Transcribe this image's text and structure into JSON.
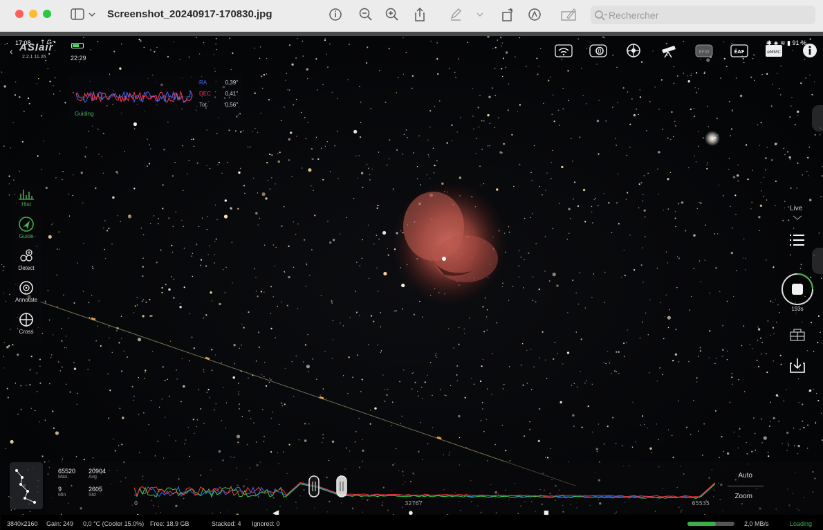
{
  "window": {
    "title": "Screenshot_20240917-170830.jpg",
    "search_placeholder": "Rechercher"
  },
  "status": {
    "time": "17:08",
    "indicators": "⇡ G •",
    "right": "✱ ◈ ≋ ▮ 91 %",
    "clock": "22:29"
  },
  "app": {
    "logo": "ASIair",
    "version": "2.2.1 11.26"
  },
  "devices": [
    {
      "name": "wifi-icon",
      "label": ""
    },
    {
      "name": "camera-icon",
      "label": "0"
    },
    {
      "name": "guide-scope-icon",
      "label": ""
    },
    {
      "name": "telescope-icon",
      "label": ""
    },
    {
      "name": "filter-wheel-icon",
      "label": "EFW"
    },
    {
      "name": "focuser-icon",
      "label": "EAF"
    },
    {
      "name": "storage-icon",
      "label": "eMMC"
    },
    {
      "name": "info-icon",
      "label": ""
    }
  ],
  "guiding": {
    "title": "Guiding",
    "ra_label": "RA",
    "ra_value": "0,39\"",
    "dec_label": "DEC",
    "dec_value": "0,41\"",
    "tot_label": "Tot",
    "tot_value": "0,56\"",
    "colors": {
      "ra": "#3a6bff",
      "dec": "#ff3a52"
    }
  },
  "left_tools": [
    {
      "name": "hist",
      "label": "Hist",
      "active": true
    },
    {
      "name": "guide",
      "label": "Guide",
      "active": true
    },
    {
      "name": "detect",
      "label": "Detect",
      "active": false
    },
    {
      "name": "annotate",
      "label": "Annotate",
      "active": false
    },
    {
      "name": "cross",
      "label": "Cross",
      "active": false
    }
  ],
  "right_tools": {
    "live_label": "Live",
    "exposure_remaining": "193s"
  },
  "histogram": {
    "max_value": "65520",
    "max_label": "Max.",
    "avg_value": "20904",
    "avg_label": "Avg",
    "min_value": "9",
    "min_label": "Min",
    "std_value": "2605",
    "std_label": "Std",
    "axis_min": "0",
    "axis_mid": "32767",
    "axis_max": "65535",
    "auto_label": "Auto",
    "zoom_label": "Zoom"
  },
  "info": {
    "resolution": "3840x2160",
    "gain": "Gain: 249",
    "temperature": "0,0 °C (Cooler 15.0%)",
    "free": "Free: 18,9 GB",
    "stacked": "Stacked: 4",
    "ignored": "Ignored: 0",
    "rate": "2,0 MB/s",
    "loading": "Loading",
    "loading_progress": 0.6
  },
  "colors": {
    "accent_green": "#4caf50",
    "red": "#ff5f57"
  }
}
